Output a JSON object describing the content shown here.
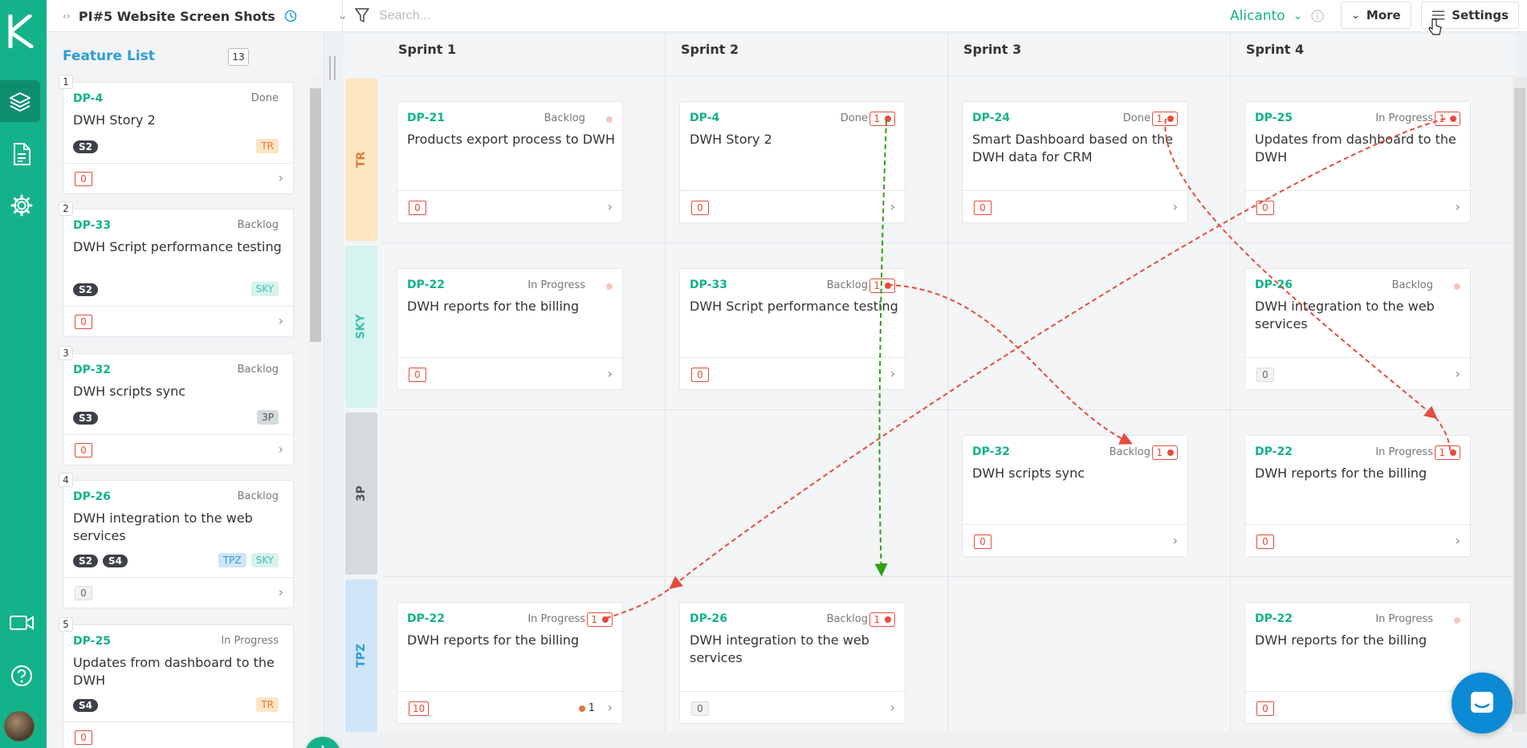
{
  "topbar": {
    "project_title": "PI#5 Website Screen Shots",
    "search_placeholder": "Search...",
    "user_name": "Alicanto",
    "more_label": "More",
    "settings_label": "Settings"
  },
  "sidebar": {
    "title": "Feature List",
    "count": "13",
    "features": [
      {
        "num": "1",
        "id": "DP-4",
        "status": "Done",
        "title": "DWH Story 2",
        "tags": [
          "S2"
        ],
        "teams": [
          "TR"
        ],
        "count": "0"
      },
      {
        "num": "2",
        "id": "DP-33",
        "status": "Backlog",
        "title": "DWH Script performance testing",
        "tags": [
          "S2"
        ],
        "teams": [
          "SKY"
        ],
        "count": "0"
      },
      {
        "num": "3",
        "id": "DP-32",
        "status": "Backlog",
        "title": "DWH scripts sync",
        "tags": [
          "S3"
        ],
        "teams": [
          "3P"
        ],
        "count": "0"
      },
      {
        "num": "4",
        "id": "DP-26",
        "status": "Backlog",
        "title": "DWH integration to the web services",
        "tags": [
          "S2",
          "S4"
        ],
        "teams": [
          "TPZ",
          "SKY"
        ],
        "count": "0"
      },
      {
        "num": "5",
        "id": "DP-25",
        "status": "In Progress",
        "title": "Updates from dashboard to the DWH",
        "tags": [
          "S4"
        ],
        "teams": [
          "TR"
        ],
        "count": "0"
      }
    ]
  },
  "board": {
    "sprints": [
      "Sprint 1",
      "Sprint 2",
      "Sprint 3",
      "Sprint 4"
    ],
    "lanes": [
      "TR",
      "SKY",
      "3P",
      "TPZ"
    ],
    "colors": {
      "TR": "#fde5c2",
      "SKY": "#d5f3ef",
      "3P": "#d5dadc",
      "TPZ": "#cfe6f7",
      "accent": "#14b28a",
      "dependency": "#e74c3c",
      "dependency_met": "#2aa10f"
    },
    "cards": {
      "tr_s1": {
        "id": "DP-21",
        "status": "Backlog",
        "title": "Products export process to DWH",
        "count": "0"
      },
      "tr_s2": {
        "id": "DP-4",
        "status": "Done",
        "title": "DWH Story 2",
        "count": "0",
        "deps": "1"
      },
      "tr_s3": {
        "id": "DP-24",
        "status": "Done",
        "title": "Smart Dashboard based on the DWH data for CRM",
        "count": "0",
        "deps": "1"
      },
      "tr_s4": {
        "id": "DP-25",
        "status": "In Progress",
        "title": "Updates from dashboard to the DWH",
        "count": "0",
        "deps": "1"
      },
      "sky_s1": {
        "id": "DP-22",
        "status": "In Progress",
        "title": "DWH reports for the billing",
        "count": "0"
      },
      "sky_s2": {
        "id": "DP-33",
        "status": "Backlog",
        "title": "DWH Script performance testing",
        "count": "0",
        "deps": "1"
      },
      "sky_s4": {
        "id": "DP-26",
        "status": "Backlog",
        "title": "DWH integration to the web services",
        "count": "0"
      },
      "p3_s3": {
        "id": "DP-32",
        "status": "Backlog",
        "title": "DWH scripts sync",
        "count": "0",
        "deps": "1"
      },
      "p3_s4": {
        "id": "DP-22",
        "status": "In Progress",
        "title": "DWH reports for the billing",
        "count": "0",
        "deps": "1"
      },
      "tpz_s1": {
        "id": "DP-22",
        "status": "In Progress",
        "title": "DWH reports for the billing",
        "count": "10",
        "deps": "1",
        "extra": "1"
      },
      "tpz_s2": {
        "id": "DP-26",
        "status": "Backlog",
        "title": "DWH integration to the web services",
        "count": "0",
        "deps": "1"
      },
      "tpz_s4": {
        "id": "DP-22",
        "status": "In Progress",
        "title": "DWH reports for the billing",
        "count": "0"
      }
    }
  }
}
